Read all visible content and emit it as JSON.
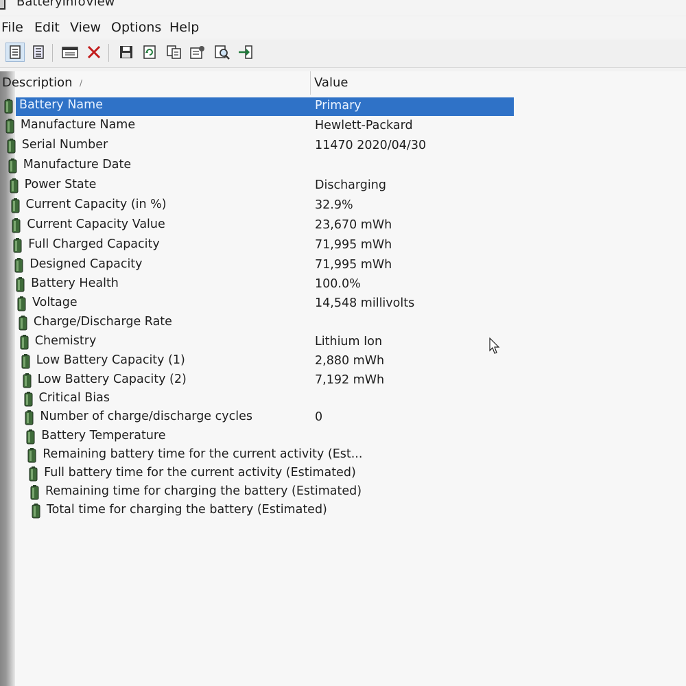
{
  "window": {
    "title": "BatteryInfoView"
  },
  "menu": {
    "items": [
      "File",
      "Edit",
      "View",
      "Options",
      "Help"
    ]
  },
  "toolbar": {
    "buttons": [
      {
        "icon": "text-report-icon",
        "active": true
      },
      {
        "icon": "html-report-icon",
        "active": false
      },
      {
        "icon": "properties-window-icon",
        "active": false
      },
      {
        "icon": "delete-x-icon",
        "active": false
      },
      {
        "icon": "save-icon",
        "active": false
      },
      {
        "icon": "refresh-icon",
        "active": false
      },
      {
        "icon": "copy-icon",
        "active": false
      },
      {
        "icon": "properties-icon",
        "active": false
      },
      {
        "icon": "find-icon",
        "active": false
      },
      {
        "icon": "exit-icon",
        "active": false
      }
    ]
  },
  "list": {
    "columns": {
      "description": "Description",
      "value": "Value"
    },
    "sort_glyph": "/",
    "selected_row_color": "#2f72c7",
    "rows": [
      {
        "description": "Battery Name",
        "value": "Primary"
      },
      {
        "description": "Manufacture Name",
        "value": "Hewlett-Packard"
      },
      {
        "description": "Serial Number",
        "value": "11470 2020/04/30"
      },
      {
        "description": "Manufacture Date",
        "value": ""
      },
      {
        "description": "Power State",
        "value": "Discharging"
      },
      {
        "description": "Current Capacity (in %)",
        "value": "32.9%"
      },
      {
        "description": "Current Capacity Value",
        "value": "23,670 mWh"
      },
      {
        "description": "Full Charged Capacity",
        "value": "71,995 mWh"
      },
      {
        "description": "Designed Capacity",
        "value": "71,995 mWh"
      },
      {
        "description": "Battery Health",
        "value": "100.0%"
      },
      {
        "description": "Voltage",
        "value": "14,548 millivolts"
      },
      {
        "description": "Charge/Discharge Rate",
        "value": ""
      },
      {
        "description": "Chemistry",
        "value": "Lithium Ion"
      },
      {
        "description": "Low Battery Capacity (1)",
        "value": "2,880 mWh"
      },
      {
        "description": "Low Battery Capacity (2)",
        "value": "7,192 mWh"
      },
      {
        "description": "Critical Bias",
        "value": ""
      },
      {
        "description": "Number of charge/discharge cycles",
        "value": "0"
      },
      {
        "description": "Battery Temperature",
        "value": ""
      },
      {
        "description": "Remaining battery time for the current activity (Est...",
        "value": ""
      },
      {
        "description": "Full battery time for the current activity (Estimated)",
        "value": ""
      },
      {
        "description": "Remaining time for charging the battery (Estimated)",
        "value": ""
      },
      {
        "description": "Total  time for charging the battery (Estimated)",
        "value": ""
      }
    ]
  }
}
